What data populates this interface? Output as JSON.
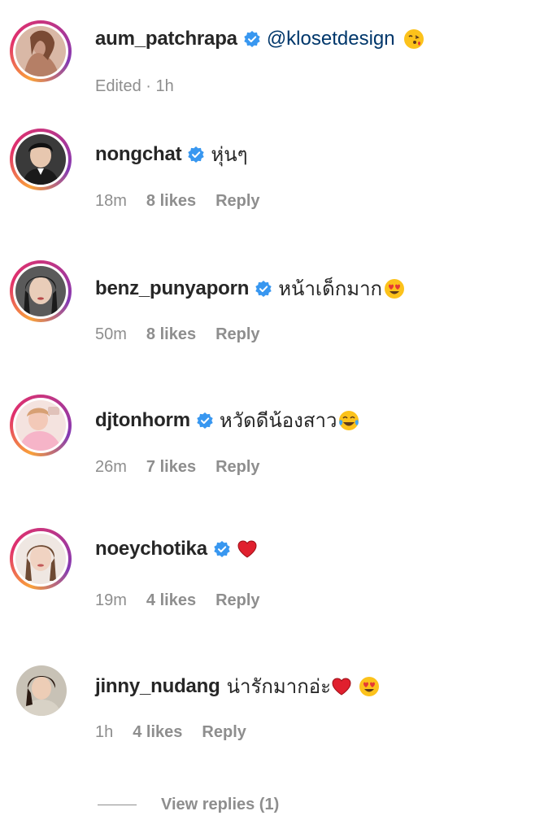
{
  "comments": [
    {
      "username": "aum_patchrapa",
      "verified": true,
      "mention": "@klosetdesign",
      "text": "",
      "emoji": "kissing-face-emoji",
      "meta": {
        "time": "Edited · 1h",
        "likes": "",
        "reply": ""
      },
      "story_ring": true
    },
    {
      "username": "nongchat",
      "verified": true,
      "mention": "",
      "text": "หุ่นๆ",
      "emoji": "",
      "meta": {
        "time": "18m",
        "likes": "8 likes",
        "reply": "Reply"
      },
      "story_ring": true
    },
    {
      "username": "benz_punyaporn",
      "verified": true,
      "mention": "",
      "text": "หน้าเด็กมาก",
      "emoji": "heart-eyes-emoji",
      "meta": {
        "time": "50m",
        "likes": "8 likes",
        "reply": "Reply"
      },
      "story_ring": true
    },
    {
      "username": "djtonhorm",
      "verified": true,
      "mention": "",
      "text": "หวัดดีน้องสาว",
      "emoji": "tears-of-joy-emoji",
      "meta": {
        "time": "26m",
        "likes": "7 likes",
        "reply": "Reply"
      },
      "story_ring": true
    },
    {
      "username": "noeychotika",
      "verified": true,
      "mention": "",
      "text": "",
      "emoji": "red-heart-emoji",
      "meta": {
        "time": "19m",
        "likes": "4 likes",
        "reply": "Reply"
      },
      "story_ring": true
    },
    {
      "username": "jinny_nudang",
      "verified": false,
      "mention": "",
      "text": "น่ารักมากอ่ะ",
      "emoji": "red-heart-and-heart-eyes-emoji",
      "meta": {
        "time": "1h",
        "likes": "4 likes",
        "reply": "Reply"
      },
      "story_ring": false
    }
  ],
  "view_replies": "View replies (1)",
  "colors": {
    "text": "#262626",
    "meta": "#8e8e8e",
    "mention": "#00376b",
    "verified": "#3897f0"
  }
}
